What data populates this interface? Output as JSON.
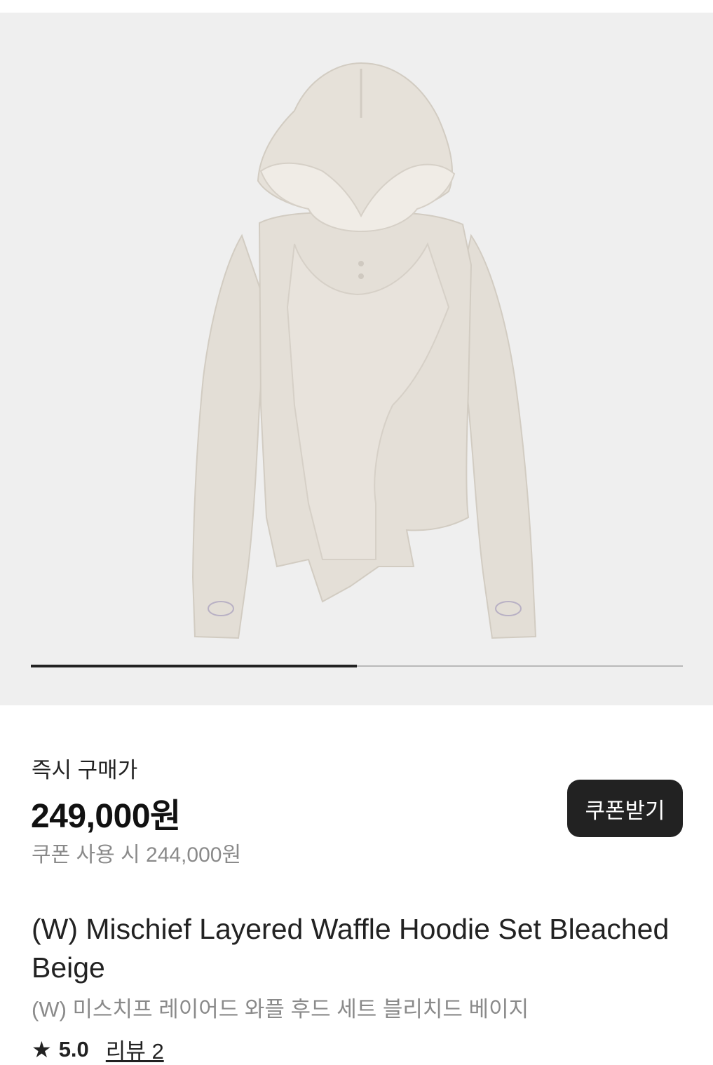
{
  "gallery": {
    "image_alt": "Hoodie product photo",
    "progress": 0.5,
    "colors": {
      "background": "#efefef",
      "garment": "#e2ddd5",
      "track": "#b9b9b9",
      "indicator": "#222222"
    }
  },
  "price": {
    "label": "즉시 구매가",
    "amount": "249,000원",
    "coupon_price": "쿠폰 사용 시 244,000원"
  },
  "coupon_button": {
    "label": "쿠폰받기"
  },
  "product": {
    "name_en": "(W) Mischief Layered Waffle Hoodie Set Bleached Beige",
    "name_ko": "(W) 미스치프 레이어드 와플 후드 세트 블리치드 베이지"
  },
  "rating": {
    "icon": "star-icon",
    "value": "5.0",
    "reviews": "리뷰 2"
  }
}
